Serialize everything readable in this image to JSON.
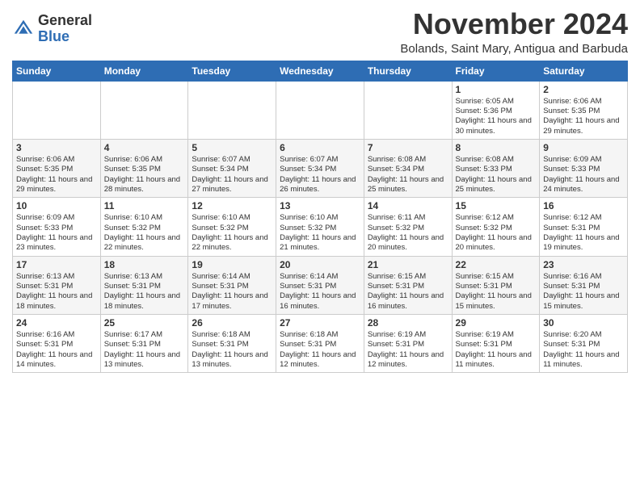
{
  "header": {
    "logo_general": "General",
    "logo_blue": "Blue",
    "month_title": "November 2024",
    "location": "Bolands, Saint Mary, Antigua and Barbuda"
  },
  "weekdays": [
    "Sunday",
    "Monday",
    "Tuesday",
    "Wednesday",
    "Thursday",
    "Friday",
    "Saturday"
  ],
  "weeks": [
    [
      {
        "day": "",
        "info": ""
      },
      {
        "day": "",
        "info": ""
      },
      {
        "day": "",
        "info": ""
      },
      {
        "day": "",
        "info": ""
      },
      {
        "day": "",
        "info": ""
      },
      {
        "day": "1",
        "info": "Sunrise: 6:05 AM\nSunset: 5:36 PM\nDaylight: 11 hours and 30 minutes."
      },
      {
        "day": "2",
        "info": "Sunrise: 6:06 AM\nSunset: 5:35 PM\nDaylight: 11 hours and 29 minutes."
      }
    ],
    [
      {
        "day": "3",
        "info": "Sunrise: 6:06 AM\nSunset: 5:35 PM\nDaylight: 11 hours and 29 minutes."
      },
      {
        "day": "4",
        "info": "Sunrise: 6:06 AM\nSunset: 5:35 PM\nDaylight: 11 hours and 28 minutes."
      },
      {
        "day": "5",
        "info": "Sunrise: 6:07 AM\nSunset: 5:34 PM\nDaylight: 11 hours and 27 minutes."
      },
      {
        "day": "6",
        "info": "Sunrise: 6:07 AM\nSunset: 5:34 PM\nDaylight: 11 hours and 26 minutes."
      },
      {
        "day": "7",
        "info": "Sunrise: 6:08 AM\nSunset: 5:34 PM\nDaylight: 11 hours and 25 minutes."
      },
      {
        "day": "8",
        "info": "Sunrise: 6:08 AM\nSunset: 5:33 PM\nDaylight: 11 hours and 25 minutes."
      },
      {
        "day": "9",
        "info": "Sunrise: 6:09 AM\nSunset: 5:33 PM\nDaylight: 11 hours and 24 minutes."
      }
    ],
    [
      {
        "day": "10",
        "info": "Sunrise: 6:09 AM\nSunset: 5:33 PM\nDaylight: 11 hours and 23 minutes."
      },
      {
        "day": "11",
        "info": "Sunrise: 6:10 AM\nSunset: 5:32 PM\nDaylight: 11 hours and 22 minutes."
      },
      {
        "day": "12",
        "info": "Sunrise: 6:10 AM\nSunset: 5:32 PM\nDaylight: 11 hours and 22 minutes."
      },
      {
        "day": "13",
        "info": "Sunrise: 6:10 AM\nSunset: 5:32 PM\nDaylight: 11 hours and 21 minutes."
      },
      {
        "day": "14",
        "info": "Sunrise: 6:11 AM\nSunset: 5:32 PM\nDaylight: 11 hours and 20 minutes."
      },
      {
        "day": "15",
        "info": "Sunrise: 6:12 AM\nSunset: 5:32 PM\nDaylight: 11 hours and 20 minutes."
      },
      {
        "day": "16",
        "info": "Sunrise: 6:12 AM\nSunset: 5:31 PM\nDaylight: 11 hours and 19 minutes."
      }
    ],
    [
      {
        "day": "17",
        "info": "Sunrise: 6:13 AM\nSunset: 5:31 PM\nDaylight: 11 hours and 18 minutes."
      },
      {
        "day": "18",
        "info": "Sunrise: 6:13 AM\nSunset: 5:31 PM\nDaylight: 11 hours and 18 minutes."
      },
      {
        "day": "19",
        "info": "Sunrise: 6:14 AM\nSunset: 5:31 PM\nDaylight: 11 hours and 17 minutes."
      },
      {
        "day": "20",
        "info": "Sunrise: 6:14 AM\nSunset: 5:31 PM\nDaylight: 11 hours and 16 minutes."
      },
      {
        "day": "21",
        "info": "Sunrise: 6:15 AM\nSunset: 5:31 PM\nDaylight: 11 hours and 16 minutes."
      },
      {
        "day": "22",
        "info": "Sunrise: 6:15 AM\nSunset: 5:31 PM\nDaylight: 11 hours and 15 minutes."
      },
      {
        "day": "23",
        "info": "Sunrise: 6:16 AM\nSunset: 5:31 PM\nDaylight: 11 hours and 15 minutes."
      }
    ],
    [
      {
        "day": "24",
        "info": "Sunrise: 6:16 AM\nSunset: 5:31 PM\nDaylight: 11 hours and 14 minutes."
      },
      {
        "day": "25",
        "info": "Sunrise: 6:17 AM\nSunset: 5:31 PM\nDaylight: 11 hours and 13 minutes."
      },
      {
        "day": "26",
        "info": "Sunrise: 6:18 AM\nSunset: 5:31 PM\nDaylight: 11 hours and 13 minutes."
      },
      {
        "day": "27",
        "info": "Sunrise: 6:18 AM\nSunset: 5:31 PM\nDaylight: 11 hours and 12 minutes."
      },
      {
        "day": "28",
        "info": "Sunrise: 6:19 AM\nSunset: 5:31 PM\nDaylight: 11 hours and 12 minutes."
      },
      {
        "day": "29",
        "info": "Sunrise: 6:19 AM\nSunset: 5:31 PM\nDaylight: 11 hours and 11 minutes."
      },
      {
        "day": "30",
        "info": "Sunrise: 6:20 AM\nSunset: 5:31 PM\nDaylight: 11 hours and 11 minutes."
      }
    ]
  ]
}
